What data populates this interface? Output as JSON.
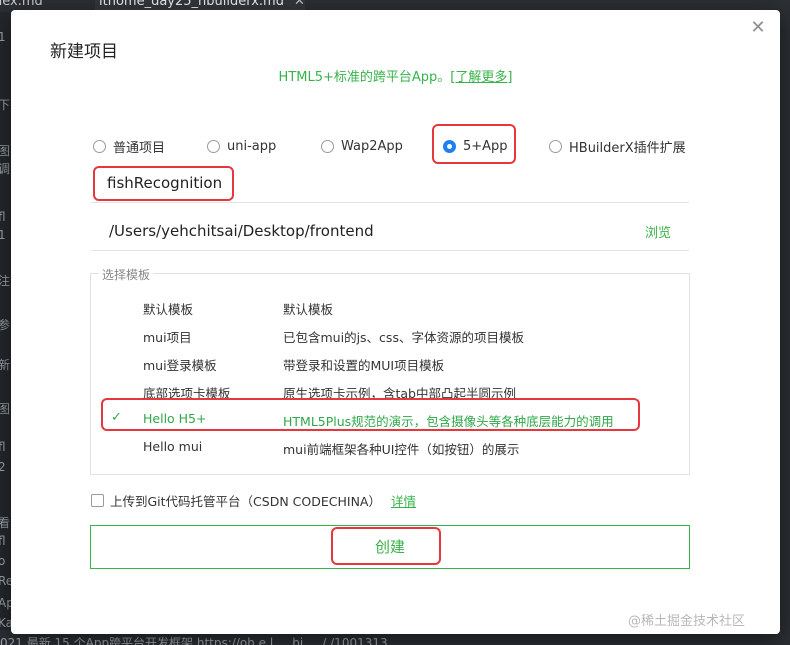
{
  "background": {
    "tabs": [
      {
        "label": "dex.md"
      },
      {
        "label": "ithome_day25_hbuilderx.md",
        "close": "✕"
      }
    ],
    "gutter_lines": [
      "1",
      "下",
      "图",
      "调",
      "fl",
      "1",
      "注",
      "参",
      "新",
      "图",
      "fl",
      "2",
      "看",
      "fl",
      "o",
      "Re",
      "Ap",
      "Ka"
    ],
    "bottom_text": "021  最新  15 个App跨平台开发框架  https://oh  e   l  ...  bi    ...   /  /1001313"
  },
  "dialog": {
    "title": "新建项目",
    "close_icon": "✕",
    "subtitle_text": "HTML5+标准的跨平台App。",
    "subtitle_link": "[了解更多]",
    "project_types": [
      {
        "label": "普通项目",
        "checked": false
      },
      {
        "label": "uni-app",
        "checked": false
      },
      {
        "label": "Wap2App",
        "checked": false
      },
      {
        "label": "5+App",
        "checked": true
      },
      {
        "label": "HBuilderX插件扩展",
        "checked": false
      }
    ],
    "project_name": "fishRecognition",
    "project_path": "/Users/yehchitsai/Desktop/frontend",
    "browse_label": "浏览",
    "template_legend": "选择模板",
    "templates": [
      {
        "name": "默认模板",
        "desc": "默认模板",
        "selected": false
      },
      {
        "name": "mui项目",
        "desc": "已包含mui的js、css、字体资源的项目模板",
        "selected": false
      },
      {
        "name": "mui登录模板",
        "desc": "带登录和设置的MUI项目模板",
        "selected": false
      },
      {
        "name": "底部选项卡模板",
        "desc": "原生选项卡示例，含tab中部凸起半圆示例",
        "selected": false
      },
      {
        "name": "Hello H5+",
        "desc": "HTML5Plus规范的演示，包含摄像头等各种底层能力的调用",
        "selected": true
      },
      {
        "name": "Hello mui",
        "desc": "mui前端框架各种UI控件（如按钮）的展示",
        "selected": false
      }
    ],
    "selected_check": "✓",
    "git_label": "上传到Git代码托管平台（CSDN CODECHINA）",
    "git_checked": false,
    "details_label": "详情",
    "create_label": "创建"
  },
  "watermark": "@稀土掘金技术社区",
  "colors": {
    "accent_green": "#37b34a",
    "radio_blue": "#1f7ff2",
    "highlight_red": "#e6373c"
  }
}
